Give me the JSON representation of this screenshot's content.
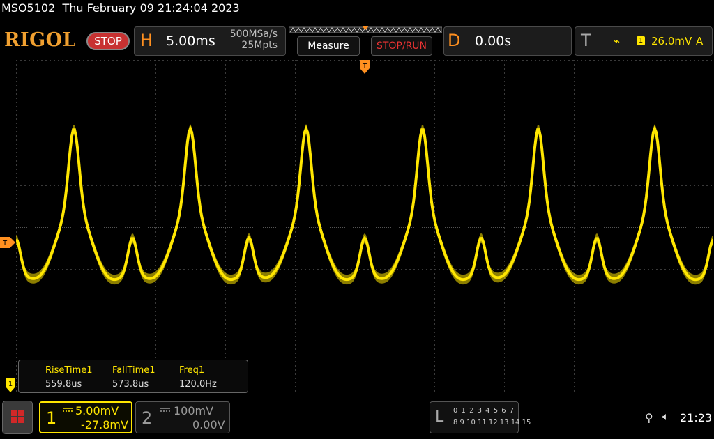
{
  "header": {
    "model": "MSO5102",
    "datetime": "Thu February 09 21:24:04 2023",
    "brand": "RIGOL",
    "acq_status": "STOP"
  },
  "horizontal": {
    "letter": "H",
    "timebase": "5.00ms",
    "sample_rate": "500MSa/s",
    "memory_depth": "25Mpts"
  },
  "buttons": {
    "measure": "Measure",
    "stop_run": "STOP/RUN"
  },
  "delay": {
    "letter": "D",
    "value": "0.00s"
  },
  "trigger": {
    "letter": "T",
    "edge_symbol": "⌁",
    "source": "1",
    "level": "26.0mV",
    "mode": "A",
    "marker": "T"
  },
  "measurements": [
    {
      "label": "RiseTime1",
      "value": "559.8us"
    },
    {
      "label": "FallTime1",
      "value": "573.8us"
    },
    {
      "label": "Freq1",
      "value": "120.0Hz"
    }
  ],
  "channel1": {
    "number": "1",
    "scale": "5.00mV",
    "offset": "-27.8mV",
    "color": "#ffe600",
    "ground_marker": "1"
  },
  "channel2": {
    "number": "2",
    "scale": "100mV",
    "offset": "0.00V"
  },
  "logic_analyzer": {
    "letter": "L",
    "row1": "0 1 2 3   4 5 6 7",
    "row2": "8 9 10 11 12 13 14 15"
  },
  "status_bar": {
    "usb_icon": "usb-icon",
    "speaker_icon": "speaker-muted-icon",
    "clock": "21:23"
  },
  "colors": {
    "trace": "#ffe600",
    "accent": "#ff9020",
    "stop": "#c83232"
  }
}
